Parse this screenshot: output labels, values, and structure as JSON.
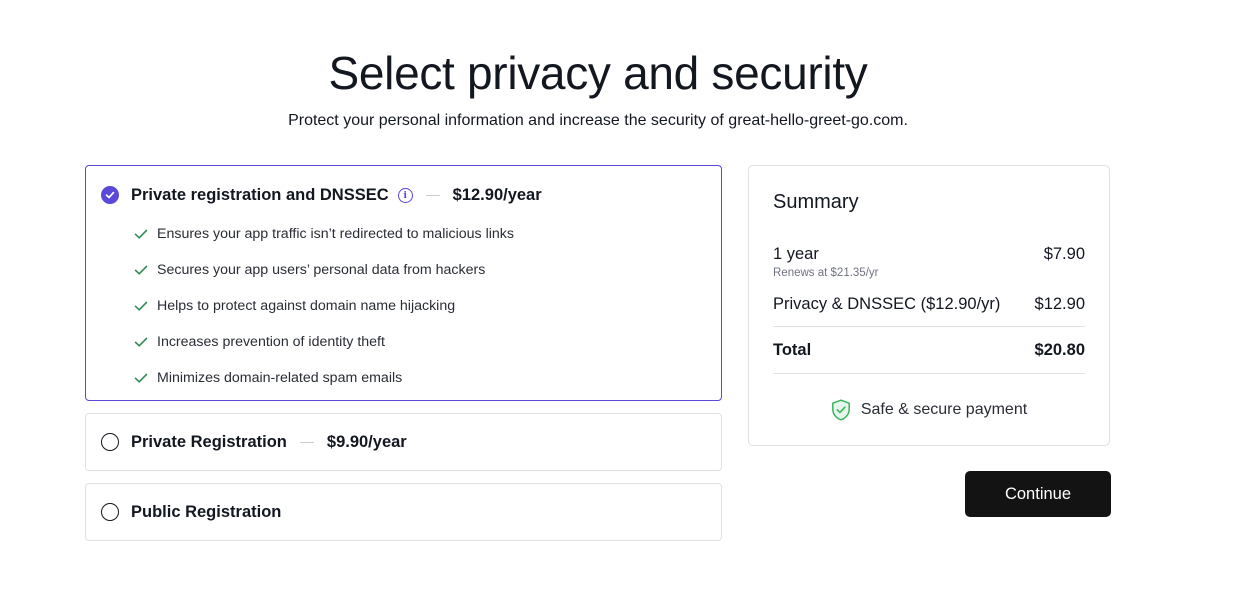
{
  "page": {
    "title": "Select privacy and security",
    "subtitle": "Protect your personal information and increase the security of great-hello-greet-go.com."
  },
  "options": [
    {
      "title": "Private registration and DNSSEC",
      "price": "$12.90/year",
      "selected": true,
      "features": [
        "Ensures your app traffic isn’t redirected to malicious links",
        "Secures your app users’ personal data from hackers",
        "Helps to protect against domain name hijacking",
        "Increases prevention of identity theft",
        "Minimizes domain-related spam emails"
      ]
    },
    {
      "title": "Private Registration",
      "price": "$9.90/year",
      "selected": false
    },
    {
      "title": "Public Registration",
      "selected": false
    }
  ],
  "summary": {
    "title": "Summary",
    "line1_label": "1 year",
    "line1_value": "$7.90",
    "renews": "Renews at $21.35/yr",
    "line2_label": "Privacy & DNSSEC ($12.90/yr)",
    "line2_value": "$12.90",
    "total_label": "Total",
    "total_value": "$20.80",
    "secure_text": "Safe & secure payment"
  },
  "continue_label": "Continue",
  "colors": {
    "accent": "#5a48d9",
    "check": "#2f8a5a",
    "shield": "#3bb55c",
    "button": "#131313"
  },
  "icons": {
    "info": "info-icon",
    "check": "check-icon",
    "shield": "shield-check-icon"
  }
}
